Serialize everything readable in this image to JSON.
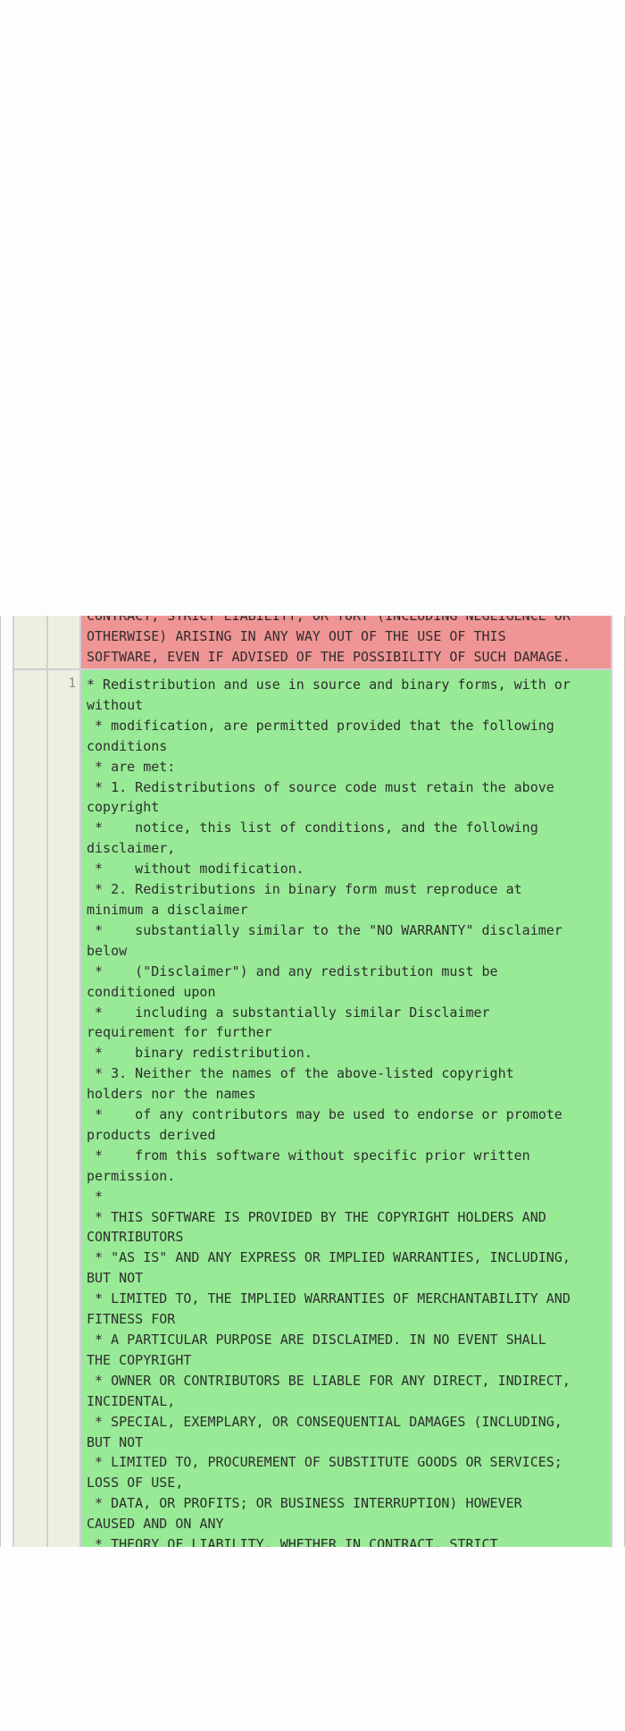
{
  "diff": {
    "removed_text": "CONTRACT, STRICT LIABILITY, OR TORT (INCLUDING NEGLIGENCE OR\nOTHERWISE) ARISING IN ANY WAY OUT OF THE USE OF THIS\nSOFTWARE, EVEN IF ADVISED OF THE POSSIBILITY OF SUCH DAMAGE.",
    "added_line_number": "1",
    "added_text": "* Redistribution and use in source and binary forms, with or\nwithout\n * modification, are permitted provided that the following\nconditions\n * are met:\n * 1. Redistributions of source code must retain the above\ncopyright\n *    notice, this list of conditions, and the following\ndisclaimer,\n *    without modification.\n * 2. Redistributions in binary form must reproduce at\nminimum a disclaimer\n *    substantially similar to the \"NO WARRANTY\" disclaimer\nbelow\n *    (\"Disclaimer\") and any redistribution must be\nconditioned upon\n *    including a substantially similar Disclaimer\nrequirement for further\n *    binary redistribution.\n * 3. Neither the names of the above-listed copyright\nholders nor the names\n *    of any contributors may be used to endorse or promote\nproducts derived\n *    from this software without specific prior written\npermission.\n *\n * THIS SOFTWARE IS PROVIDED BY THE COPYRIGHT HOLDERS AND\nCONTRIBUTORS\n * \"AS IS\" AND ANY EXPRESS OR IMPLIED WARRANTIES, INCLUDING,\nBUT NOT\n * LIMITED TO, THE IMPLIED WARRANTIES OF MERCHANTABILITY AND\nFITNESS FOR\n * A PARTICULAR PURPOSE ARE DISCLAIMED. IN NO EVENT SHALL\nTHE COPYRIGHT\n * OWNER OR CONTRIBUTORS BE LIABLE FOR ANY DIRECT, INDIRECT,\nINCIDENTAL,\n * SPECIAL, EXEMPLARY, OR CONSEQUENTIAL DAMAGES (INCLUDING,\nBUT NOT\n * LIMITED TO, PROCUREMENT OF SUBSTITUTE GOODS OR SERVICES;\nLOSS OF USE,\n * DATA, OR PROFITS; OR BUSINESS INTERRUPTION) HOWEVER\nCAUSED AND ON ANY\n * THEORY OF LIABILITY, WHETHER IN CONTRACT, STRICT",
    "colors": {
      "removed_bg": "#f09595",
      "added_bg": "#98ea96",
      "gutter_bg": "#efefdf"
    }
  }
}
